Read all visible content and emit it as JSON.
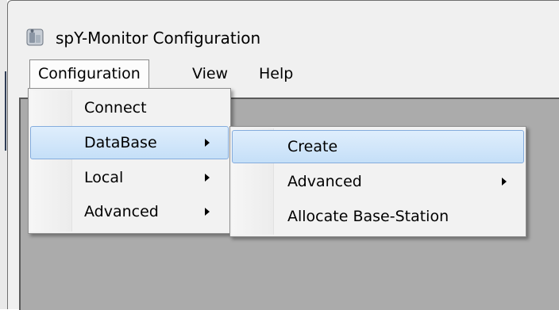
{
  "window": {
    "title": "spY-Monitor Configuration"
  },
  "menubar": {
    "items": [
      {
        "label": "Configuration"
      },
      {
        "label": "View"
      },
      {
        "label": "Help"
      }
    ]
  },
  "configuration_menu": {
    "items": [
      {
        "label": "Connect"
      },
      {
        "label": "DataBase"
      },
      {
        "label": "Local"
      },
      {
        "label": "Advanced"
      }
    ]
  },
  "database_submenu": {
    "items": [
      {
        "label": "Create"
      },
      {
        "label": "Advanced"
      },
      {
        "label": "Allocate Base-Station"
      }
    ]
  },
  "colors": {
    "highlight_border": "#84acdd",
    "highlight_fill": "#cfe4fa",
    "client_area": "#ababab"
  }
}
